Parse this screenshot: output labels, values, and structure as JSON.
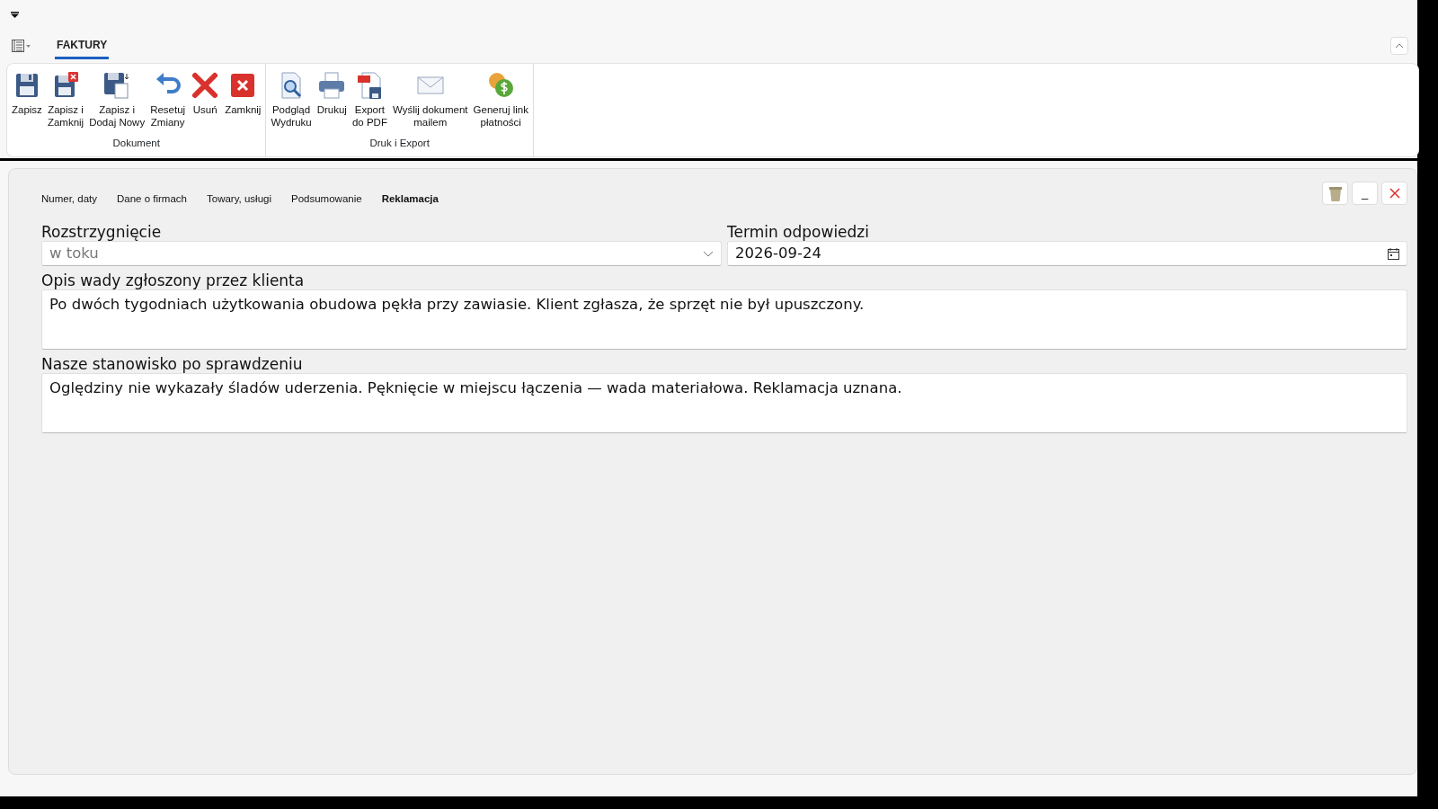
{
  "ribbon_tabs": [
    {
      "label": "FAKTURY",
      "selected": true
    }
  ],
  "ribbon_groups": [
    {
      "label": "Dokument",
      "buttons": [
        {
          "label": "Zapisz",
          "kind": "save"
        },
        {
          "label": "Zapisz i\nZamknij",
          "kind": "save-close"
        },
        {
          "label": "Zapisz i\nDodaj Nowy",
          "kind": "save-new"
        },
        {
          "label": "Resetuj\nZmiany",
          "kind": "undo"
        },
        {
          "label": "Usuń",
          "kind": "delete"
        },
        {
          "label": "Zamknij",
          "kind": "close"
        }
      ]
    },
    {
      "label": "Druk i Export",
      "buttons": [
        {
          "label": "Podgląd\nWydruku",
          "kind": "preview"
        },
        {
          "label": "Drukuj",
          "kind": "print"
        },
        {
          "label": "Export\ndo PDF",
          "kind": "pdf"
        },
        {
          "label": "Wyślij dokument\nmailem",
          "kind": "mail"
        },
        {
          "label": "Generuj link\npłatności",
          "kind": "coins"
        }
      ]
    }
  ],
  "form_tabs": [
    {
      "label": "Numer, daty",
      "selected": false
    },
    {
      "label": "Dane o firmach",
      "selected": false
    },
    {
      "label": "Towary, usługi",
      "selected": false
    },
    {
      "label": "Podsumowanie",
      "selected": false
    },
    {
      "label": "Reklamacja",
      "selected": true
    }
  ],
  "window_buttons": [
    {
      "kind": "trash"
    },
    {
      "kind": "minimize",
      "label": "_"
    },
    {
      "kind": "close"
    }
  ],
  "fields": [
    {
      "kind": "dropdown",
      "label": "Rozstrzygnięcie",
      "value": "w toku",
      "disabled": true
    },
    {
      "kind": "date",
      "label": "Termin odpowiedzi",
      "value": "2026-09-24",
      "disabled": false
    },
    {
      "kind": "textarea",
      "label": "Opis wady zgłoszony przez klienta",
      "value": "Po dwóch tygodniach użytkowania obudowa pękła przy zawiasie. Klient zgłasza, że sprzęt nie był upuszczony."
    },
    {
      "kind": "textarea",
      "label": "Nasze stanowisko po sprawdzeniu",
      "value": "Oględziny nie wykazały śladów uderzenia. Pęknięcie w miejscu łączenia — wada materiałowa. Reklamacja uznana."
    }
  ]
}
